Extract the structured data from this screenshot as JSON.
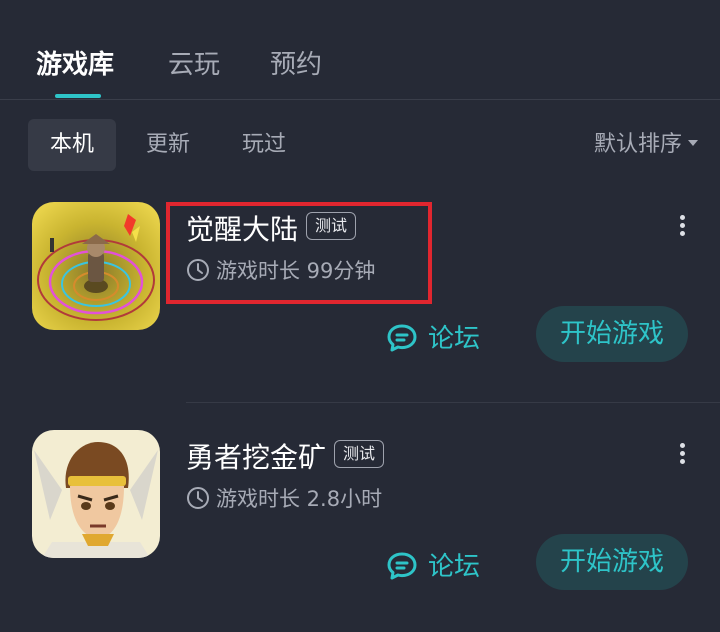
{
  "tabs": [
    {
      "label": "游戏库",
      "active": true
    },
    {
      "label": "云玩",
      "active": false
    },
    {
      "label": "预约",
      "active": false
    }
  ],
  "filters": [
    {
      "label": "本机",
      "active": true
    },
    {
      "label": "更新",
      "active": false
    },
    {
      "label": "玩过",
      "active": false
    }
  ],
  "sort": {
    "label": "默认排序",
    "icon": "caret-down-icon"
  },
  "games": [
    {
      "title": "觉醒大陆",
      "badge": "测试",
      "playtime": "游戏时长 99分钟",
      "forum_label": "论坛",
      "play_label": "开始游戏",
      "icon": "awakening-land-game-icon"
    },
    {
      "title": "勇者挖金矿",
      "badge": "测试",
      "playtime": "游戏时长 2.8小时",
      "forum_label": "论坛",
      "play_label": "开始游戏",
      "icon": "hero-gold-mine-game-icon"
    }
  ],
  "colors": {
    "accent": "#2ec4c8",
    "background": "#262a36",
    "highlight": "#e0262f"
  }
}
